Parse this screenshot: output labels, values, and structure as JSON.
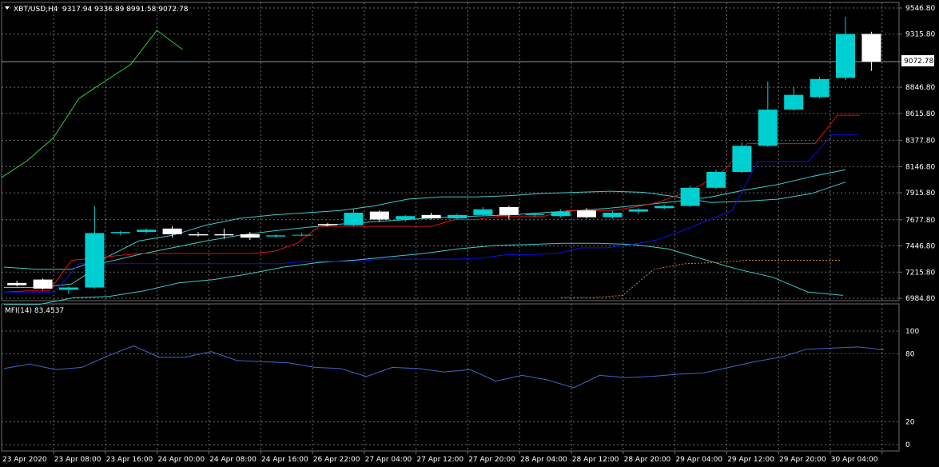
{
  "header": {
    "symbol_label": "XBT/USD,H4",
    "ohlc_text": "9317.94 9336.89 8991.58 9072.78",
    "collapse_icon": "triangle-down-icon"
  },
  "indicator": {
    "label": "MFI(14) 83.4537"
  },
  "current_price_label": "9072.78",
  "colors": {
    "background": "#000000",
    "grid": "#6e6e6e",
    "bull": "#00cfd1",
    "bear": "#ffffff",
    "axis_text": "#ffffff",
    "green_line": "#33c733",
    "red_line": "#e01010",
    "blue_line": "#1010e6",
    "cyan_line": "#40c8c8",
    "mfi_line": "#3f67c9",
    "orange_dotted": "#c8823c"
  },
  "chart_data": [
    {
      "type": "candlestick",
      "title": "XBT/USD,H4",
      "price_axis_ticks": [
        "9546.80",
        "9315.80",
        "9072.78",
        "8846.80",
        "8615.80",
        "8377.80",
        "8146.80",
        "7915.80",
        "7677.80",
        "7446.80",
        "7215.80",
        "6984.80"
      ],
      "ylim": [
        6984.8,
        9546.8
      ],
      "time_axis_labels": [
        "23 Apr 2020",
        "23 Apr 08:00",
        "23 Apr 16:00",
        "24 Apr 00:00",
        "24 Apr 08:00",
        "24 Apr 16:00",
        "26 Apr 22:00",
        "27 Apr 04:00",
        "27 Apr 12:00",
        "27 Apr 20:00",
        "28 Apr 04:00",
        "28 Apr 12:00",
        "28 Apr 20:00",
        "29 Apr 04:00",
        "29 Apr 12:00",
        "29 Apr 20:00",
        "30 Apr 04:00"
      ],
      "candles": [
        {
          "o": 7120,
          "h": 7140,
          "l": 7090,
          "c": 7100
        },
        {
          "o": 7150,
          "h": 7160,
          "l": 7060,
          "c": 7070
        },
        {
          "o": 7060,
          "h": 7090,
          "l": 7020,
          "c": 7080
        },
        {
          "o": 7080,
          "h": 7800,
          "l": 7070,
          "c": 7560
        },
        {
          "o": 7560,
          "h": 7580,
          "l": 7540,
          "c": 7570
        },
        {
          "o": 7570,
          "h": 7600,
          "l": 7560,
          "c": 7590
        },
        {
          "o": 7600,
          "h": 7620,
          "l": 7520,
          "c": 7550
        },
        {
          "o": 7550,
          "h": 7570,
          "l": 7530,
          "c": 7540
        },
        {
          "o": 7550,
          "h": 7600,
          "l": 7510,
          "c": 7540
        },
        {
          "o": 7550,
          "h": 7570,
          "l": 7500,
          "c": 7520
        },
        {
          "o": 7530,
          "h": 7550,
          "l": 7520,
          "c": 7540
        },
        {
          "o": 7540,
          "h": 7560,
          "l": 7530,
          "c": 7545
        },
        {
          "o": 7640,
          "h": 7650,
          "l": 7620,
          "c": 7630
        },
        {
          "o": 7630,
          "h": 7770,
          "l": 7620,
          "c": 7740
        },
        {
          "o": 7750,
          "h": 7760,
          "l": 7660,
          "c": 7680
        },
        {
          "o": 7680,
          "h": 7720,
          "l": 7660,
          "c": 7710
        },
        {
          "o": 7720,
          "h": 7740,
          "l": 7680,
          "c": 7690
        },
        {
          "o": 7690,
          "h": 7730,
          "l": 7680,
          "c": 7720
        },
        {
          "o": 7720,
          "h": 7790,
          "l": 7710,
          "c": 7770
        },
        {
          "o": 7790,
          "h": 7800,
          "l": 7680,
          "c": 7720
        },
        {
          "o": 7720,
          "h": 7740,
          "l": 7700,
          "c": 7730
        },
        {
          "o": 7710,
          "h": 7770,
          "l": 7700,
          "c": 7750
        },
        {
          "o": 7760,
          "h": 7780,
          "l": 7690,
          "c": 7700
        },
        {
          "o": 7700,
          "h": 7760,
          "l": 7690,
          "c": 7740
        },
        {
          "o": 7750,
          "h": 7780,
          "l": 7730,
          "c": 7770
        },
        {
          "o": 7780,
          "h": 7810,
          "l": 7770,
          "c": 7800
        },
        {
          "o": 7800,
          "h": 7980,
          "l": 7790,
          "c": 7960
        },
        {
          "o": 7960,
          "h": 8120,
          "l": 7950,
          "c": 8100
        },
        {
          "o": 8100,
          "h": 8360,
          "l": 8090,
          "c": 8330
        },
        {
          "o": 8330,
          "h": 8900,
          "l": 8320,
          "c": 8650
        },
        {
          "o": 8650,
          "h": 8850,
          "l": 8640,
          "c": 8780
        },
        {
          "o": 8760,
          "h": 8940,
          "l": 8750,
          "c": 8920
        },
        {
          "o": 8930,
          "h": 9470,
          "l": 8910,
          "c": 9317.94
        },
        {
          "o": 9317.94,
          "h": 9336.89,
          "l": 8991.58,
          "c": 9072.78
        }
      ],
      "lines": {
        "green": [
          8050,
          8200,
          8400,
          8750,
          8900,
          9050,
          9350,
          9180,
          null
        ],
        "red": [
          7040,
          7050,
          7050,
          7320,
          7340,
          7360,
          7380,
          7380,
          7380,
          7380,
          7380,
          7380,
          7400,
          7470,
          7620,
          7620,
          7620,
          7620,
          7620,
          7620,
          7680,
          7680,
          7710,
          7710,
          7710,
          7760,
          7760,
          7760,
          7790,
          7830,
          7900,
          7990,
          8120,
          8350,
          8350,
          8350,
          8350,
          8600,
          8600
        ],
        "blue": [
          7040,
          7040,
          7040,
          7290,
          7290,
          7290,
          7290,
          7290,
          7290,
          7290,
          7290,
          7290,
          7310,
          7310,
          7310,
          7330,
          7330,
          7330,
          7330,
          7340,
          7370,
          7370,
          7380,
          7430,
          7430,
          7460,
          7500,
          7580,
          7670,
          7760,
          8190,
          8190,
          8190,
          8430,
          8430
        ],
        "bb_mid": [
          7080,
          7080,
          7110,
          7300,
          7370,
          7430,
          7490,
          7540,
          7580,
          7610,
          7640,
          7660,
          7680,
          7700,
          7710,
          7720,
          7740,
          7760,
          7780,
          7810,
          7840,
          7880,
          7940,
          7990,
          8060,
          8120
        ],
        "bb_up": [
          7260,
          7240,
          7240,
          7340,
          7490,
          7540,
          7630,
          7690,
          7720,
          7740,
          7760,
          7800,
          7860,
          7880,
          7880,
          7890,
          7910,
          7920,
          7930,
          7920,
          7880,
          7830,
          7840,
          7860,
          7910,
          8010
        ],
        "bb_low": [
          6930,
          6930,
          6990,
          7000,
          7050,
          7120,
          7150,
          7200,
          7260,
          7300,
          7320,
          7350,
          7380,
          7420,
          7450,
          7460,
          7470,
          7470,
          7460,
          7420,
          7330,
          7240,
          7170,
          7040,
          7010
        ],
        "orange_dotted": [
          6990,
          6990,
          7010,
          7240,
          7290,
          7300,
          7320,
          7320,
          7320,
          7320
        ]
      }
    },
    {
      "type": "line",
      "title": "MFI(14) 83.4537",
      "ylim": [
        0,
        100
      ],
      "yticks": [
        "100",
        "80",
        "20",
        "0"
      ],
      "values": [
        67,
        71,
        66,
        68,
        78,
        87,
        77,
        77,
        82,
        74,
        73,
        72,
        68,
        67,
        60,
        68,
        67,
        64,
        66,
        56,
        61,
        57,
        50,
        61,
        59,
        60,
        62,
        63,
        68,
        73,
        77,
        84,
        85,
        86,
        83.45
      ]
    }
  ]
}
